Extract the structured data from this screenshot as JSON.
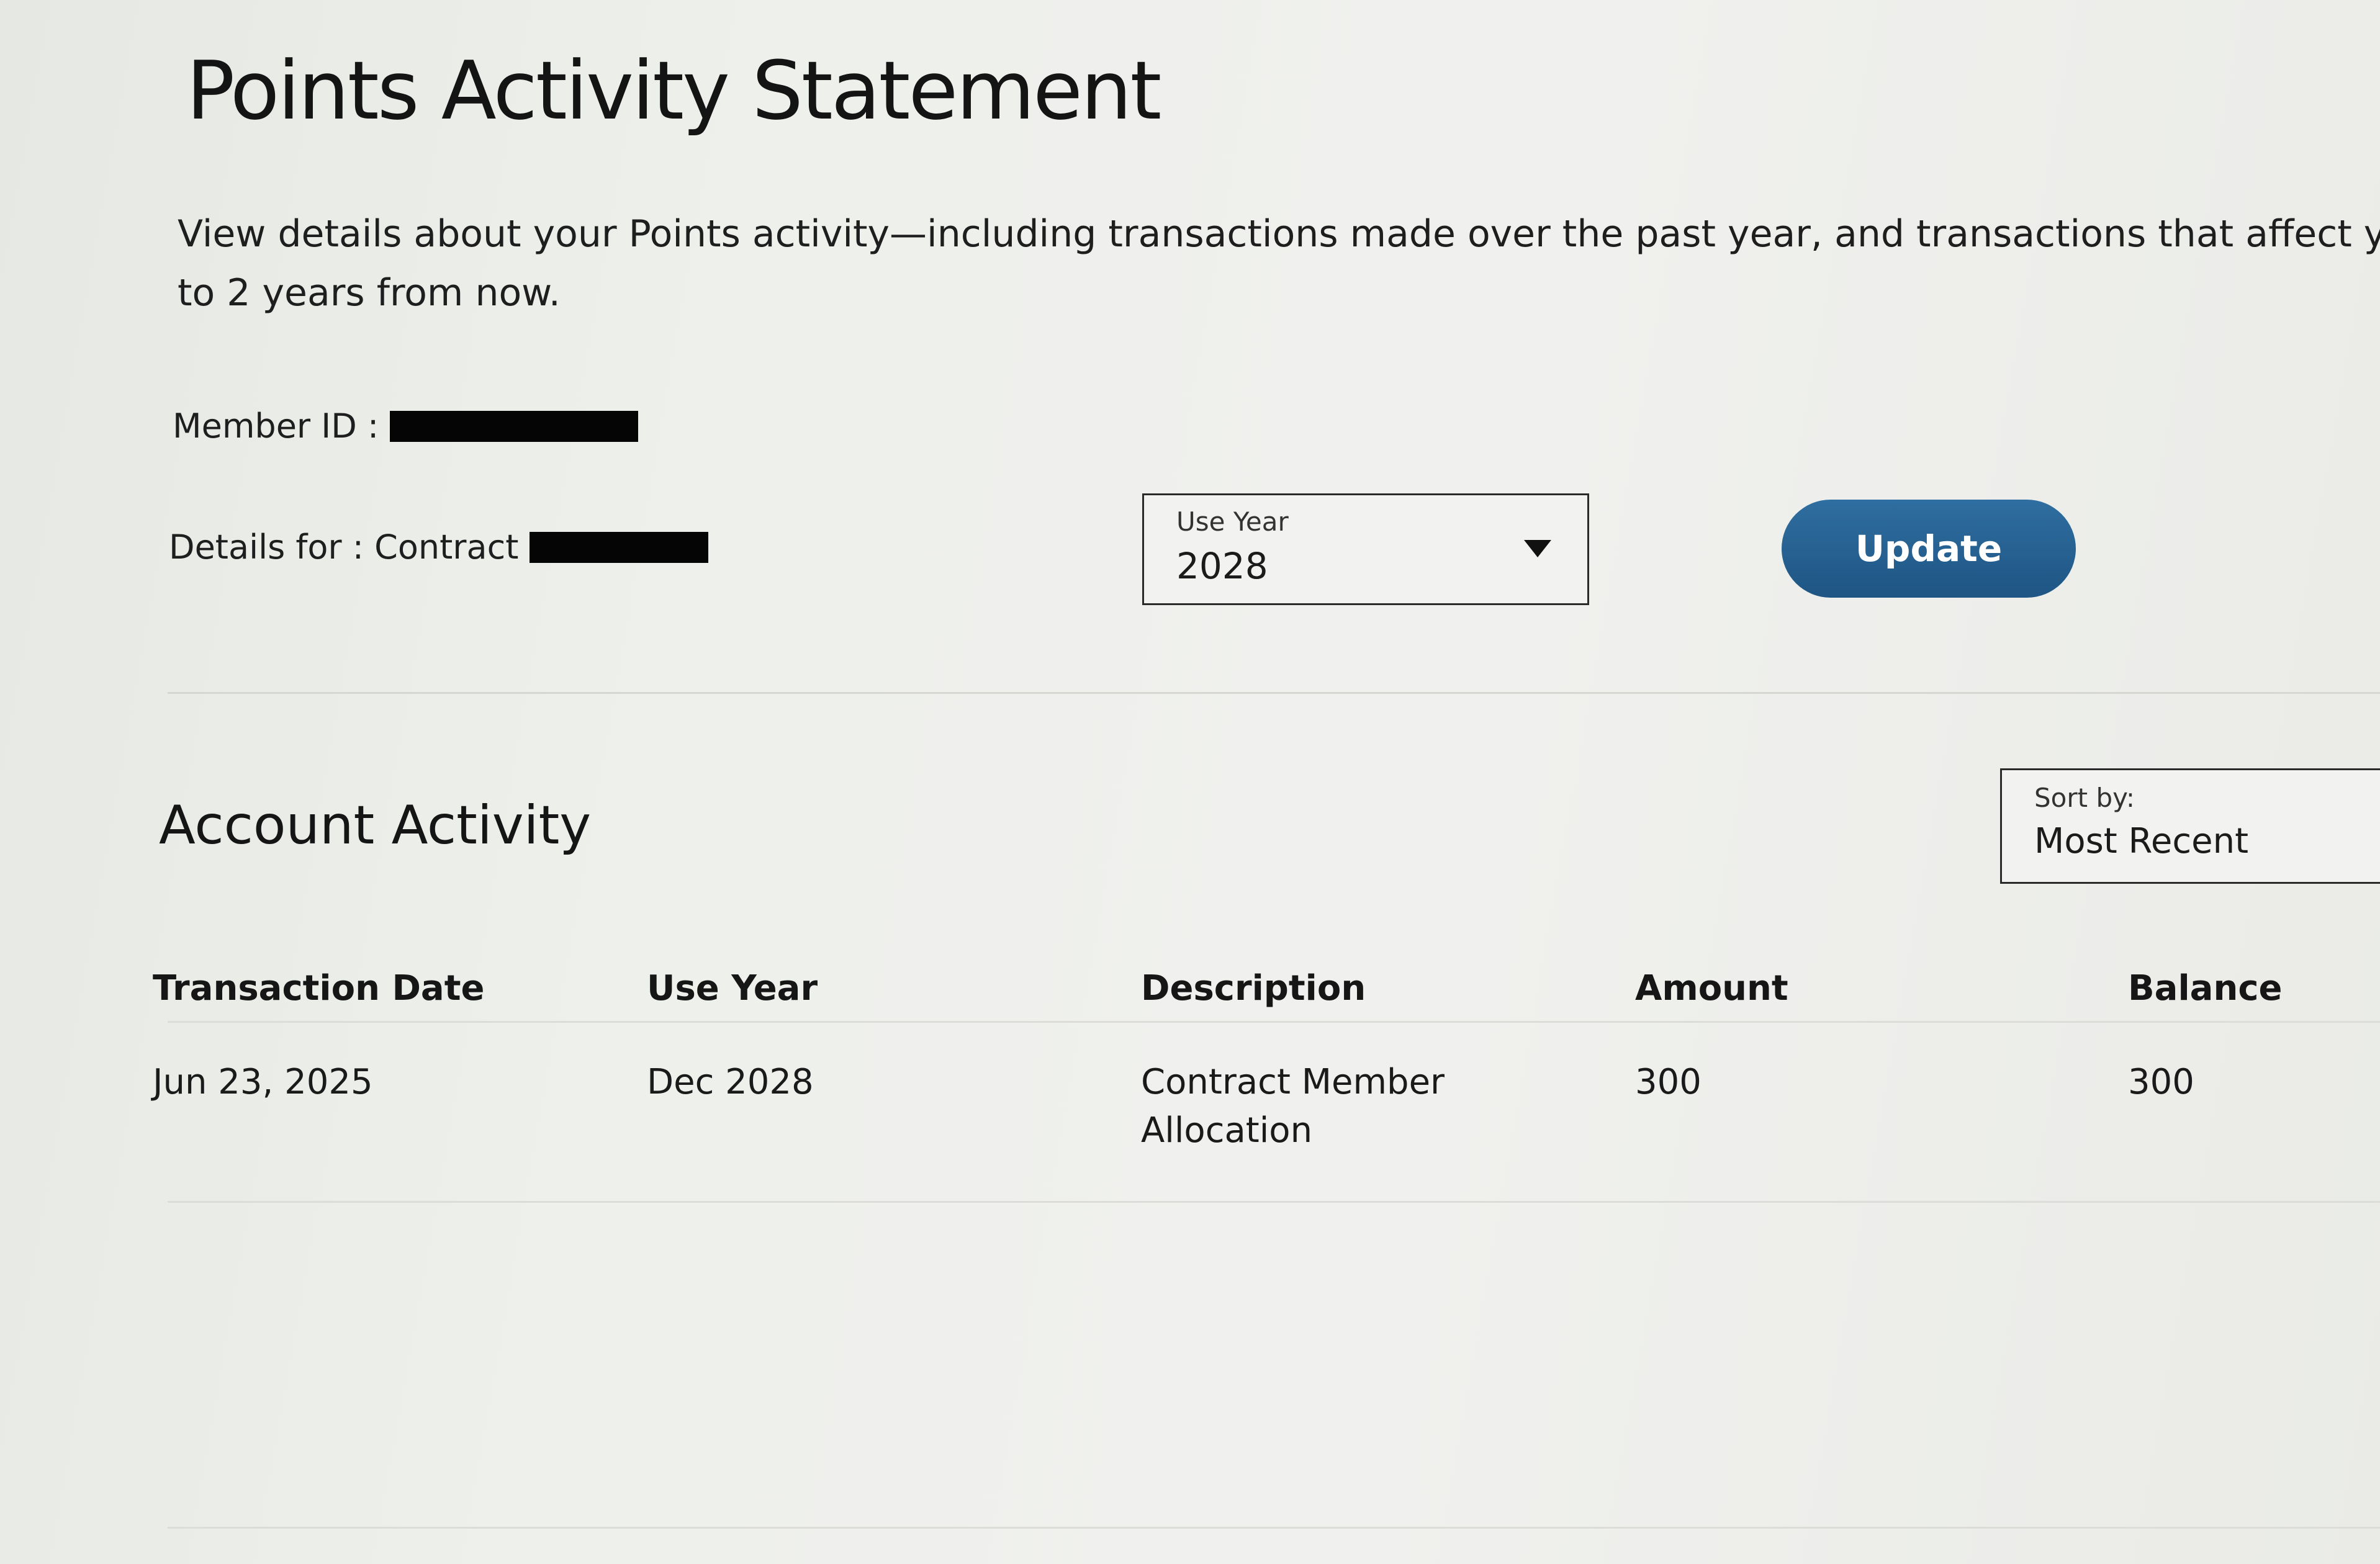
{
  "page": {
    "title": "Points Activity Statement",
    "intro_line1": "View details about your Points activity—including transactions made over the past year, and transactions that affect your Mem",
    "intro_line2": "to 2 years from now."
  },
  "member": {
    "member_id_label": "Member ID :",
    "details_for_label": "Details for : Contract"
  },
  "use_year_select": {
    "label": "Use Year",
    "value": "2028"
  },
  "update_button": {
    "label": "Update"
  },
  "account_activity": {
    "title": "Account Activity",
    "sort": {
      "label": "Sort by:",
      "value": "Most Recent"
    },
    "columns": [
      "Transaction Date",
      "Use Year",
      "Description",
      "Amount",
      "Balance"
    ],
    "rows": [
      {
        "transaction_date": "Jun 23, 2025",
        "use_year": "Dec 2028",
        "description_line1": "Contract Member",
        "description_line2": "Allocation",
        "amount": "300",
        "balance": "300"
      }
    ]
  },
  "colors": {
    "button": "#2a6496",
    "background": "#eef0ec",
    "text": "#1b1b1b"
  }
}
